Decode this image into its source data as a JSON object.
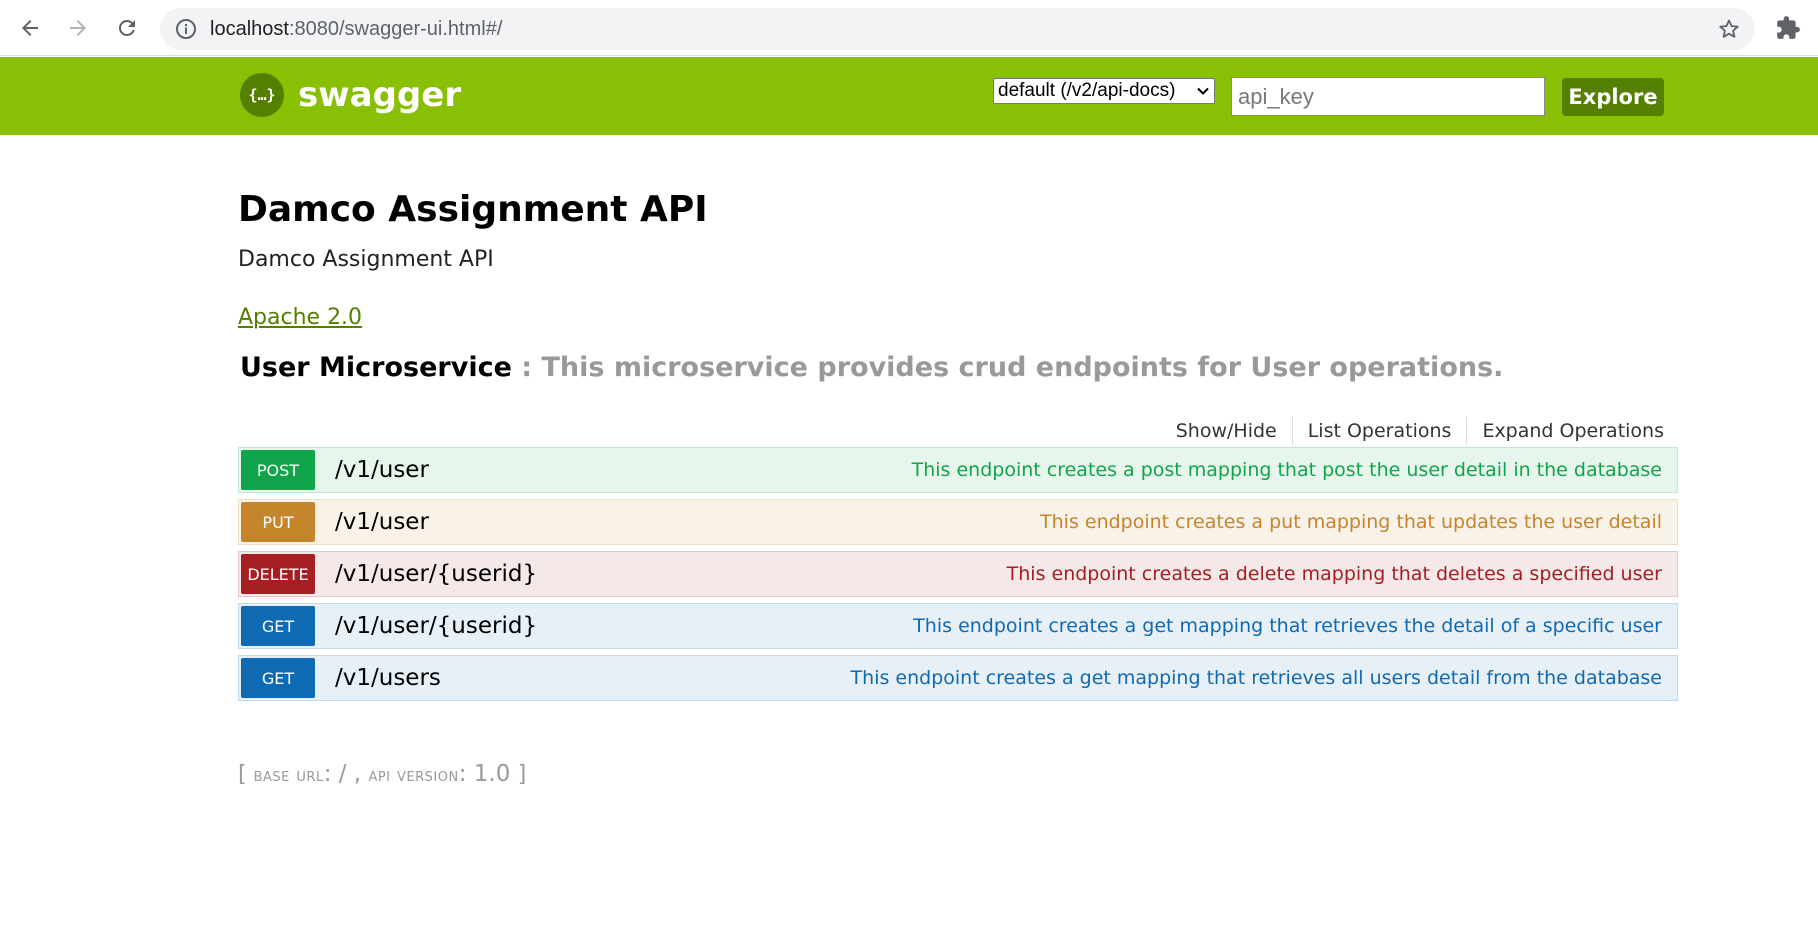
{
  "browser": {
    "url_host": "localhost",
    "url_rest": ":8080/swagger-ui.html#/"
  },
  "header": {
    "logo_text": "swagger",
    "logo_glyph": "{…}",
    "spec_selected": "default (/v2/api-docs)",
    "api_key_placeholder": "api_key",
    "explore_label": "Explore",
    "brand_color": "#89bf04",
    "button_color": "#547f00"
  },
  "info": {
    "title": "Damco Assignment API",
    "description": "Damco Assignment API",
    "license": "Apache 2.0"
  },
  "resource": {
    "name": "User Microservice",
    "description": " : This microservice provides crud endpoints for User operations.",
    "links": {
      "show_hide": "Show/Hide",
      "list_operations": "List Operations",
      "expand_operations": "Expand Operations"
    }
  },
  "operations": [
    {
      "method": "POST",
      "path": "/v1/user",
      "summary": "This endpoint creates a post mapping that post the user detail in the database"
    },
    {
      "method": "PUT",
      "path": "/v1/user",
      "summary": "This endpoint creates a put mapping that updates the user detail"
    },
    {
      "method": "DELETE",
      "path": "/v1/user/{userid}",
      "summary": "This endpoint creates a delete mapping that deletes a specified user"
    },
    {
      "method": "GET",
      "path": "/v1/user/{userid}",
      "summary": "This endpoint creates a get mapping that retrieves the detail of a specific user"
    },
    {
      "method": "GET",
      "path": "/v1/users",
      "summary": "This endpoint creates a get mapping that retrieves all users detail from the database"
    }
  ],
  "footer": {
    "open_bracket": "[ ",
    "base_url_label": "base url",
    "base_url_value": ": / , ",
    "api_version_label": "api version",
    "api_version_value": ": 1.0 ",
    "close_bracket": "]"
  }
}
